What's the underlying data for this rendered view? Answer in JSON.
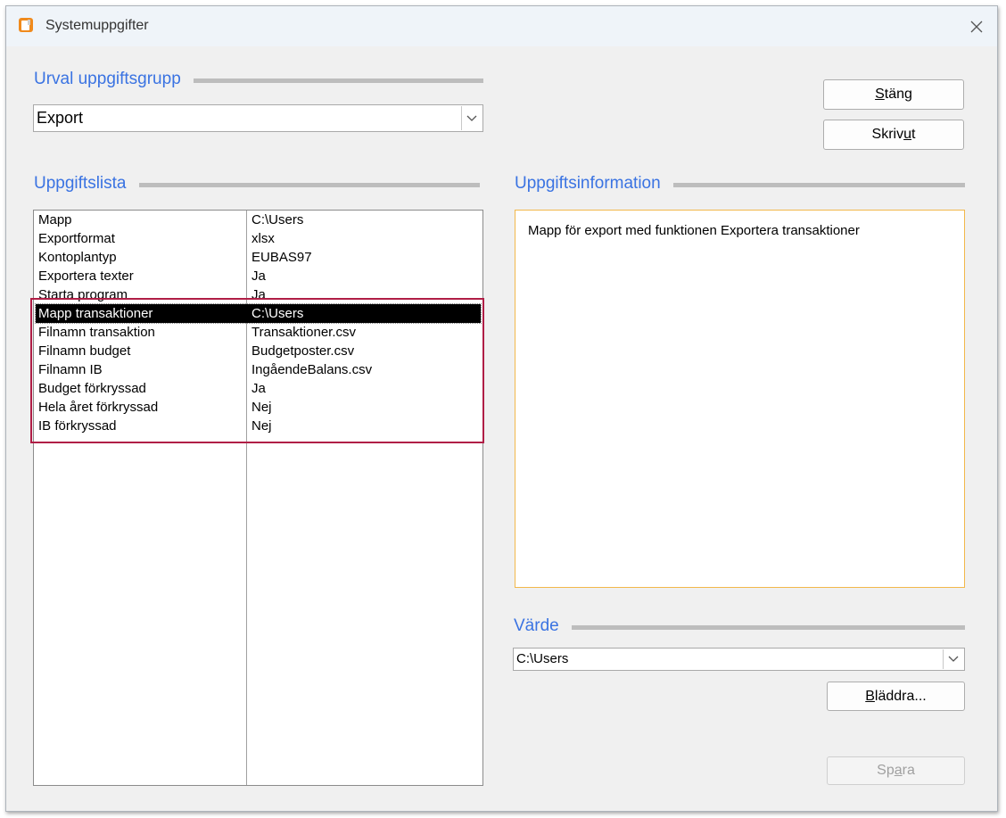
{
  "window": {
    "title": "Systemuppgifter"
  },
  "urval": {
    "title": "Urval uppgiftsgrupp",
    "selected": "Export"
  },
  "buttons": {
    "close": {
      "pre": "",
      "key": "S",
      "post": "täng"
    },
    "print": {
      "pre": "Skriv ",
      "key": "u",
      "post": "t"
    },
    "browse": {
      "pre": "",
      "key": "B",
      "post": "läddra..."
    },
    "save": {
      "pre": "Sp",
      "key": "a",
      "post": "ra"
    }
  },
  "list": {
    "title": "Uppgiftslista",
    "rows": [
      {
        "name": "Mapp",
        "value": "C:\\Users"
      },
      {
        "name": "Exportformat",
        "value": "xlsx"
      },
      {
        "name": "Kontoplantyp",
        "value": "EUBAS97"
      },
      {
        "name": "Exportera texter",
        "value": "Ja"
      },
      {
        "name": "Starta program",
        "value": "Ja"
      },
      {
        "name": "Mapp  transaktioner",
        "value": "C:\\Users"
      },
      {
        "name": "Filnamn transaktion",
        "value": "Transaktioner.csv"
      },
      {
        "name": "Filnamn budget",
        "value": "Budgetposter.csv"
      },
      {
        "name": "Filnamn IB",
        "value": "IngåendeBalans.csv"
      },
      {
        "name": "Budget förkryssad",
        "value": "Ja"
      },
      {
        "name": "Hela året förkryssad",
        "value": "Nej"
      },
      {
        "name": "IB förkryssad",
        "value": "Nej"
      }
    ]
  },
  "info": {
    "title": "Uppgiftsinformation",
    "text": "Mapp för export med funktionen Exportera transaktioner"
  },
  "value": {
    "title": "Värde",
    "current": "C:\\Users"
  },
  "colors": {
    "accent": "#3a73e2",
    "highlight": "#b01e46",
    "info_border": "#f2b84b"
  }
}
